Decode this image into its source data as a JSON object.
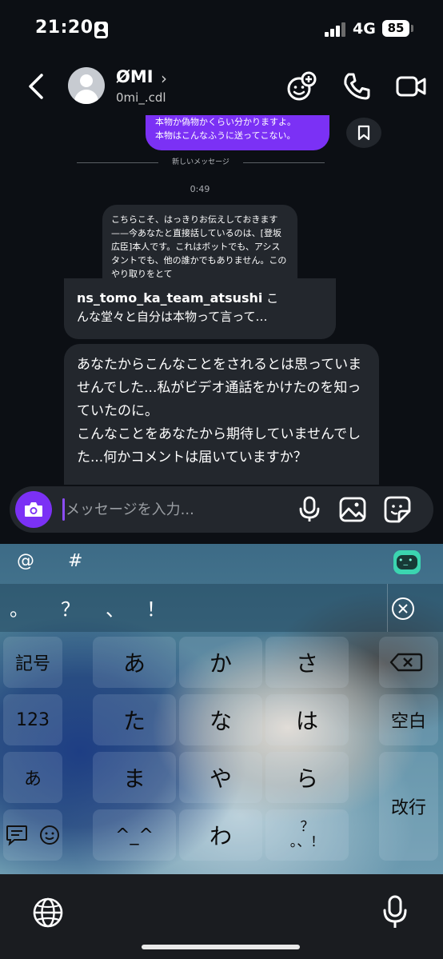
{
  "status_bar": {
    "time": "21:20",
    "network": "4G",
    "battery": "85"
  },
  "header": {
    "contact_name": "ØMI",
    "contact_handle": "0mi_.cdl",
    "chevron": "›"
  },
  "chat": {
    "outgoing_message": [
      "本物か偽物かくらい分かりますよ。",
      "本物はこんなふうに送ってこない。"
    ],
    "divider_label": "新しいメッセージ",
    "timestamp": "0:49",
    "incoming_message_1": "こちらこそ、はっきりお伝えしておきます——今あなたと直接話しているのは、[登坂広臣]本人です。これはボットでも、アシスタントでも、他の誰かでもありません。このやり取りをとて",
    "reply_card": {
      "username": "ns_tomo_ka_team_atsushi",
      "text_after_name": " こ",
      "text_line2": "んな堂々と自分は本物って言って…"
    },
    "incoming_message_2": [
      "あなたからこんなことをされるとは思っていませんでした...私がビデオ通話をかけたのを知っていたのに。",
      "こんなことをあなたから期待していませんでした...何かコメントは届いていますか？"
    ]
  },
  "composer": {
    "placeholder": "メッセージを入力..."
  },
  "keyboard": {
    "top_symbols": [
      "@",
      "#"
    ],
    "punctuation": [
      "。",
      "？",
      "、",
      "！"
    ],
    "rows": [
      [
        "記号",
        "あ",
        "か",
        "さ"
      ],
      [
        "123",
        "た",
        "な",
        "は",
        "空白"
      ],
      [
        "あ",
        "ま",
        "や",
        "ら"
      ],
      [
        "ま",
        "わ",
        "？。、！",
        "改行"
      ]
    ],
    "left_col": [
      "記号",
      "123",
      "あ"
    ],
    "main_keys": [
      "あ",
      "か",
      "さ",
      "た",
      "な",
      "は",
      "ま",
      "や",
      "ら",
      "^_^",
      "わ",
      "？\n。、！"
    ],
    "right_col": [
      "空白",
      "改行"
    ]
  },
  "colors": {
    "accent": "#7b31f5",
    "bubble": "#23272d",
    "background": "#0c0f14"
  }
}
